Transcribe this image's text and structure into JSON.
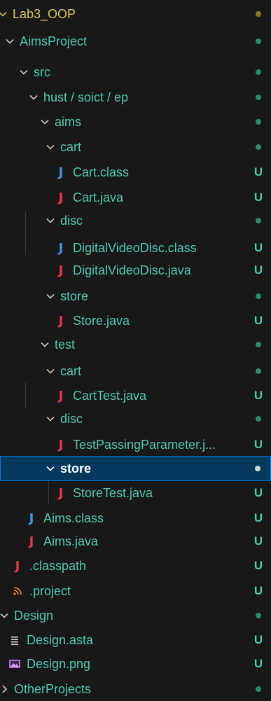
{
  "tree": {
    "rows": [
      {
        "label": "Lab3_OOP",
        "status": "",
        "kind": "root-folder",
        "icon": "chevron-down-icon"
      },
      {
        "label": "AimsProject",
        "status": "",
        "kind": "folder",
        "icon": "chevron-down-icon"
      },
      {
        "label": "src",
        "status": "",
        "kind": "folder",
        "icon": "chevron-down-icon"
      },
      {
        "label": "hust / soict / ep",
        "status": "",
        "kind": "folder",
        "icon": "chevron-down-icon"
      },
      {
        "label": "aims",
        "status": "",
        "kind": "folder",
        "icon": "chevron-down-icon"
      },
      {
        "label": "cart",
        "status": "",
        "kind": "folder",
        "icon": "chevron-down-icon"
      },
      {
        "label": "Cart.class",
        "status": "U",
        "kind": "class-file",
        "icon": "java-class-icon"
      },
      {
        "label": "Cart.java",
        "status": "U",
        "kind": "java-file",
        "icon": "java-file-icon"
      },
      {
        "label": "disc",
        "status": "",
        "kind": "folder",
        "icon": "chevron-down-icon"
      },
      {
        "label": "DigitalVideoDisc.class",
        "status": "U",
        "kind": "class-file",
        "icon": "java-class-icon"
      },
      {
        "label": "DigitalVideoDisc.java",
        "status": "U",
        "kind": "java-file",
        "icon": "java-file-icon"
      },
      {
        "label": "store",
        "status": "",
        "kind": "folder",
        "icon": "chevron-down-icon"
      },
      {
        "label": "Store.java",
        "status": "U",
        "kind": "java-file",
        "icon": "java-file-icon"
      },
      {
        "label": "test",
        "status": "",
        "kind": "folder",
        "icon": "chevron-down-icon"
      },
      {
        "label": "cart",
        "status": "",
        "kind": "folder",
        "icon": "chevron-down-icon"
      },
      {
        "label": "CartTest.java",
        "status": "U",
        "kind": "java-file",
        "icon": "java-file-icon"
      },
      {
        "label": "disc",
        "status": "",
        "kind": "folder",
        "icon": "chevron-down-icon"
      },
      {
        "label": "TestPassingParameter.j...",
        "status": "U",
        "kind": "java-file",
        "icon": "java-file-icon"
      },
      {
        "label": "store",
        "status": "",
        "kind": "folder-selected",
        "icon": "chevron-down-icon"
      },
      {
        "label": "StoreTest.java",
        "status": "U",
        "kind": "java-file",
        "icon": "java-file-icon"
      },
      {
        "label": "Aims.class",
        "status": "U",
        "kind": "class-file",
        "icon": "java-class-icon"
      },
      {
        "label": "Aims.java",
        "status": "U",
        "kind": "java-file",
        "icon": "java-file-icon"
      },
      {
        "label": ".classpath",
        "status": "U",
        "kind": "java-file",
        "icon": "java-file-icon"
      },
      {
        "label": ".project",
        "status": "U",
        "kind": "rss-file",
        "icon": "rss-icon"
      },
      {
        "label": "Design",
        "status": "",
        "kind": "folder",
        "icon": "chevron-down-icon"
      },
      {
        "label": "Design.asta",
        "status": "U",
        "kind": "text-file",
        "icon": "text-lines-icon"
      },
      {
        "label": "Design.png",
        "status": "U",
        "kind": "image-file",
        "icon": "image-icon"
      },
      {
        "label": "OtherProjects",
        "status": "",
        "kind": "folder-collapsed",
        "icon": "chevron-right-icon"
      }
    ]
  },
  "colors": {
    "background": "#181818",
    "folder_text": "#4ec9b0",
    "root_text": "#d7c75a",
    "selection_bg": "#04395e",
    "selection_border": "#0078d4",
    "java_icon": "#e8364a",
    "class_icon": "#4a90e2"
  }
}
